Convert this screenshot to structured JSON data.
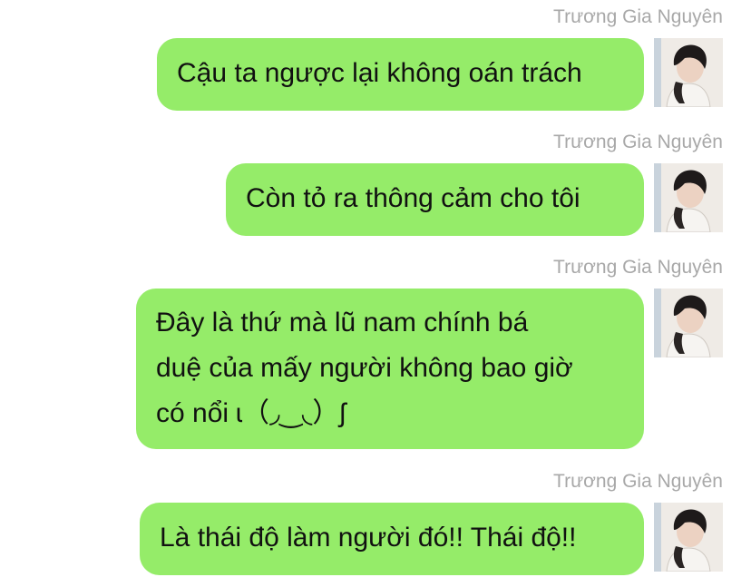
{
  "messages": [
    {
      "sender": "Trương Gia Nguyên",
      "lines": [
        "Cậu ta ngược lại không oán trách"
      ]
    },
    {
      "sender": "Trương Gia Nguyên",
      "lines": [
        "Còn tỏ ra thông cảm cho tôi"
      ]
    },
    {
      "sender": "Trương Gia Nguyên",
      "lines": [
        " Đây là thứ mà lũ nam chính bá",
        "duệ của mấy người không bao giờ",
        "có nổi ɩ（◞‿◟）ʃ"
      ]
    },
    {
      "sender": "Trương Gia Nguyên",
      "lines": [
        "Là thái độ làm người đó!! Thái độ!!"
      ]
    }
  ],
  "avatar_icon": "user-photo-avatar",
  "colors": {
    "bubble": "#95ec69",
    "sender_name": "#a8a8a8",
    "background": "#ffffff"
  }
}
